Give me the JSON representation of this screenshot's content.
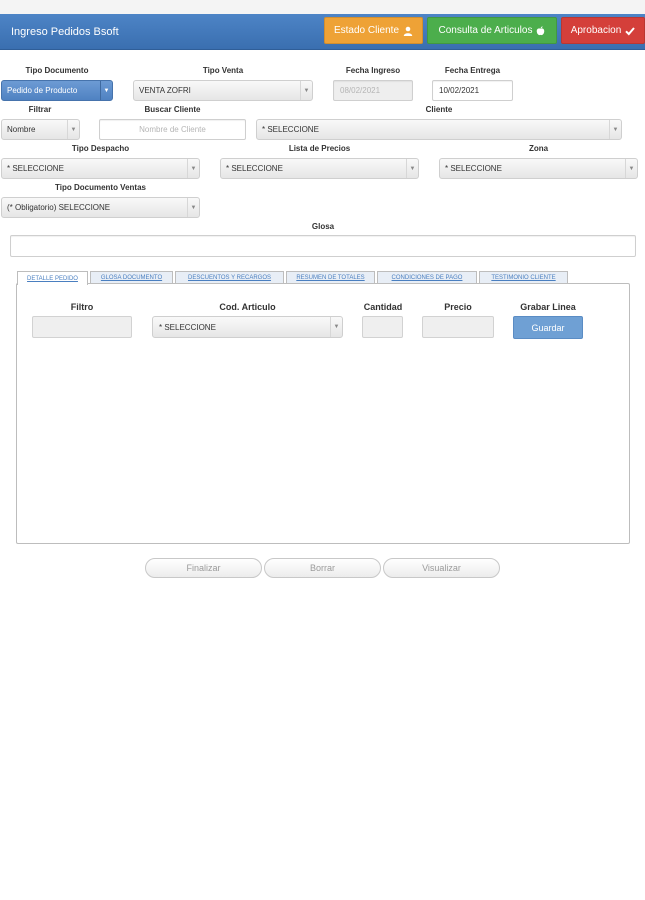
{
  "app": {
    "title": "Ingreso Pedidos Bsoft"
  },
  "header_buttons": {
    "estado": "Estado Cliente",
    "consulta": "Consulta de Articulos",
    "aprobacion": "Aprobacion"
  },
  "form": {
    "tipo_documento": {
      "label": "Tipo Documento",
      "value": "Pedido de Producto"
    },
    "tipo_venta": {
      "label": "Tipo Venta",
      "value": "VENTA ZOFRI"
    },
    "fecha_ingreso": {
      "label": "Fecha Ingreso",
      "value": "08/02/2021"
    },
    "fecha_entrega": {
      "label": "Fecha Entrega",
      "value": "10/02/2021"
    },
    "filtrar": {
      "label": "Filtrar",
      "value": "Nombre"
    },
    "buscar_cliente": {
      "label": "Buscar Cliente",
      "placeholder": "Nombre de Cliente"
    },
    "cliente": {
      "label": "Cliente",
      "value": "* SELECCIONE"
    },
    "tipo_despacho": {
      "label": "Tipo Despacho",
      "value": "* SELECCIONE"
    },
    "lista_precios": {
      "label": "Lista de Precios",
      "value": "* SELECCIONE"
    },
    "zona": {
      "label": "Zona",
      "value": "* SELECCIONE"
    },
    "tipo_documento_ventas": {
      "label": "Tipo Documento Ventas",
      "value": "(* Obligatorio) SELECCIONE"
    },
    "glosa": {
      "label": "Glosa",
      "value": ""
    }
  },
  "tabs": [
    {
      "label": "DETALLE PEDIDO"
    },
    {
      "label": "GLOSA DOCUMENTO"
    },
    {
      "label": "DESCUENTOS Y RECARGOS"
    },
    {
      "label": "RESUMEN DE TOTALES"
    },
    {
      "label": "CONDICIONES DE PAGO"
    },
    {
      "label": "TESTIMONIO CLIENTE"
    }
  ],
  "detalle": {
    "col_filtro": "Filtro",
    "col_articulo": "Cod. Articulo",
    "col_cantidad": "Cantidad",
    "col_precio": "Precio",
    "col_grabar": "Grabar Linea",
    "articulo_value": "* SELECCIONE",
    "guardar": "Guardar"
  },
  "actions": {
    "finalizar": "Finalizar",
    "borrar": "Borrar",
    "visualizar": "Visualizar"
  },
  "colors": {
    "header_blue": "#3a6fb0",
    "estado_orange": "#eea236",
    "consulta_green": "#4cae4c",
    "aprobacion_red": "#d43f3a",
    "guardar_blue": "#6fa0d4"
  },
  "icons": {
    "estado": "user-icon",
    "consulta": "apple-icon",
    "aprobacion": "check-icon"
  }
}
